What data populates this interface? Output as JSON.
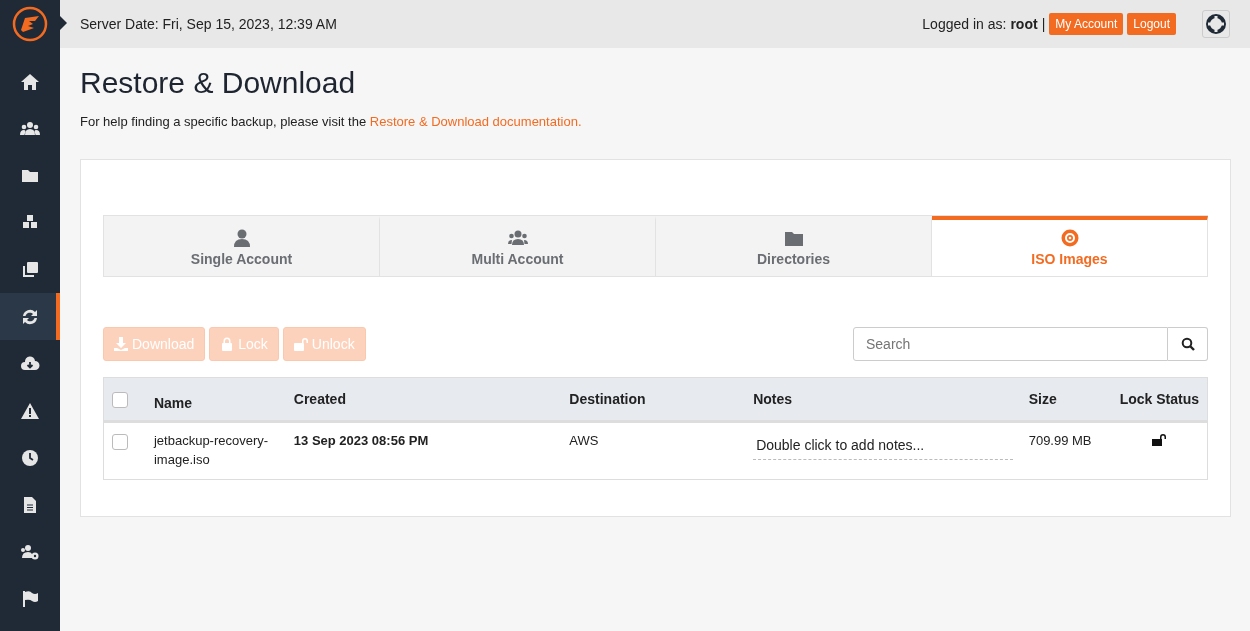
{
  "sidebar": {
    "items": [
      {
        "selected": false
      },
      {
        "selected": false
      },
      {
        "selected": false
      },
      {
        "selected": false
      },
      {
        "selected": false
      },
      {
        "selected": true
      },
      {
        "selected": false
      },
      {
        "selected": false
      },
      {
        "selected": false
      },
      {
        "selected": false
      },
      {
        "selected": false
      },
      {
        "selected": false
      }
    ]
  },
  "header": {
    "server_date": "Server Date: Fri, Sep 15, 2023, 12:39 AM",
    "logged_in_label": "Logged in as:",
    "user": "root",
    "separator": "|",
    "buttons": [
      "My Account",
      "Logout"
    ]
  },
  "page": {
    "title": "Restore & Download",
    "help_text": "For help finding a specific backup, please visit the",
    "help_link": "Restore & Download documentation."
  },
  "tabs": [
    {
      "label": "Single Account",
      "selected": false
    },
    {
      "label": "Multi Account",
      "selected": false
    },
    {
      "label": "Directories",
      "selected": false
    },
    {
      "label": "ISO Images",
      "selected": true
    }
  ],
  "actions": [
    {
      "label": "Download",
      "disabled": true
    },
    {
      "label": "Lock",
      "disabled": true
    },
    {
      "label": "Unlock",
      "disabled": true
    }
  ],
  "search": {
    "placeholder": "Search"
  },
  "table": {
    "select_all_checked": false,
    "columns": [
      "Name",
      "Created",
      "Destination",
      "Notes",
      "Size",
      "Lock Status"
    ],
    "rows": [
      {
        "checked": false,
        "name": "jetbackup-recovery-image.iso",
        "created": "13 Sep 2023 08:56 PM",
        "destination": "AWS",
        "notes": "Double click to add notes...",
        "size": "709.99 MB",
        "locked": false
      }
    ]
  }
}
